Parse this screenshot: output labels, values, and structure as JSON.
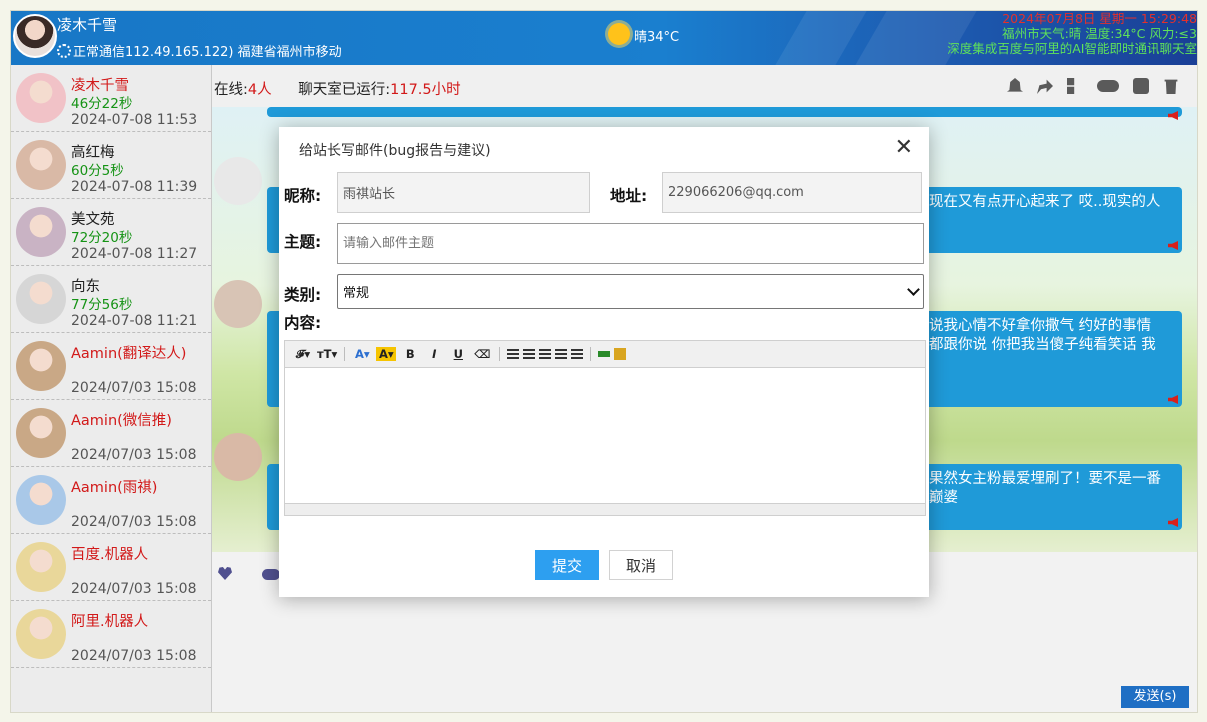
{
  "header": {
    "user_name": "凌木千雪",
    "status": "正常通信112.49.165.122)  福建省福州市移动",
    "weather": "晴34°C",
    "date_line": "2024年07月8日   星期一 15:29:48",
    "weather_detail": "福州市天气:晴 温度:34°C 风力:≤3",
    "slogan": "深度集成百度与阿里的AI智能即时通讯聊天室"
  },
  "sidebar": {
    "users": [
      {
        "name": "凌木千雪",
        "duration": "46分22秒",
        "time": "2024-07-08 11:53",
        "name_red": true,
        "avatar_color": "#f1c2c7"
      },
      {
        "name": "高红梅",
        "duration": "60分5秒",
        "time": "2024-07-08 11:39",
        "name_red": false,
        "avatar_color": "#d9b9a6"
      },
      {
        "name": "美文苑",
        "duration": "72分20秒",
        "time": "2024-07-08 11:27",
        "name_red": false,
        "avatar_color": "#c9b3c4"
      },
      {
        "name": "向东",
        "duration": "77分56秒",
        "time": "2024-07-08 11:21",
        "name_red": false,
        "avatar_color": "#d6d6d6"
      },
      {
        "name": "Aamin(翻译达人)",
        "duration": "",
        "time": "2024/07/03 15:08",
        "name_red": true,
        "avatar_color": "#c9a886"
      },
      {
        "name": "Aamin(微信推)",
        "duration": "",
        "time": "2024/07/03 15:08",
        "name_red": true,
        "avatar_color": "#c9a886"
      },
      {
        "name": "Aamin(雨祺)",
        "duration": "",
        "time": "2024/07/03 15:08",
        "name_red": true,
        "avatar_color": "#a9c8e8"
      },
      {
        "name": "百度.机器人",
        "duration": "",
        "time": "2024/07/03 15:08",
        "name_red": true,
        "avatar_color": "#e9d79a"
      },
      {
        "name": "阿里.机器人",
        "duration": "",
        "time": "2024/07/03 15:08",
        "name_red": true,
        "avatar_color": "#e9d79a"
      }
    ]
  },
  "topbar": {
    "online_label": "在线:",
    "online_count": "4人",
    "runtime_label": "聊天室已运行:",
    "runtime_value": "117.5小时"
  },
  "chat": {
    "messages": [
      {
        "text": "现在又有点开心起来了 哎..现实的人"
      },
      {
        "text": "说我心情不好拿你撒气 约好的事情\n都跟你说 你把我当傻子纯看笑话 我"
      },
      {
        "text": "果然女主粉最爱埋刷了！要不是一番\n巅婆"
      }
    ],
    "send_label": "发送(s)"
  },
  "modal": {
    "title": "给站长写邮件(bug报告与建议)",
    "close_symbol": "✕",
    "nickname_label": "昵称:",
    "nickname_value": "雨祺站长",
    "address_label": "地址:",
    "address_value": "229066206@qq.com",
    "subject_label": "主题:",
    "subject_placeholder": "请输入邮件主题",
    "category_label": "类别:",
    "category_value": "常规",
    "content_label": "内容:",
    "toolbar": {
      "font_family": "𝓕▾",
      "font_size": "тT▾",
      "font_color": "A▾",
      "highlight": "A▾",
      "bold": "B",
      "italic": "I",
      "underline": "U",
      "eraser": "⌫"
    },
    "submit_label": "提交",
    "cancel_label": "取消"
  }
}
